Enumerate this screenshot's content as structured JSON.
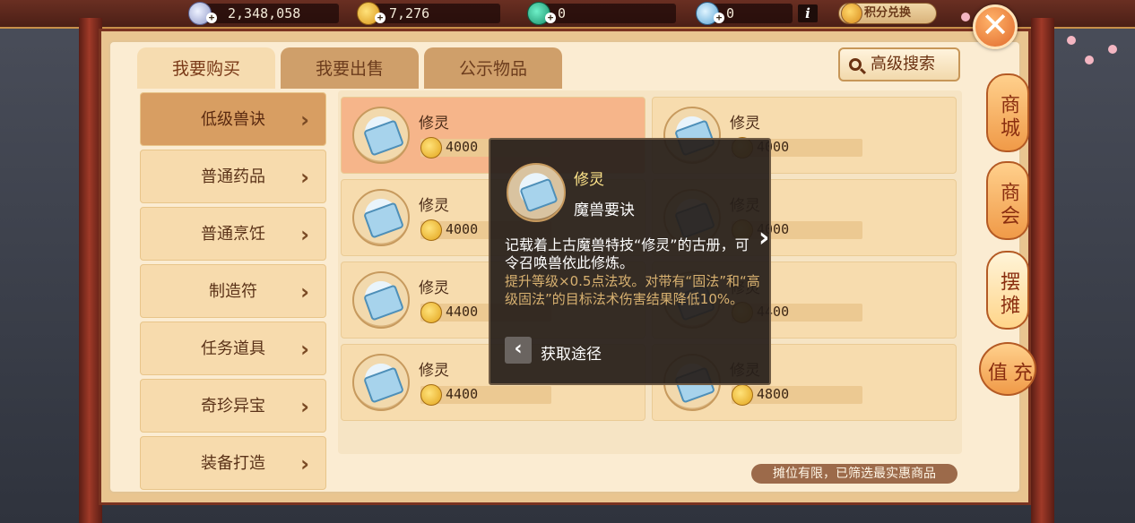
{
  "colors": {
    "accent": "#e06a2c",
    "panel_bg": "#fbecd2",
    "tab_active_bg": "#f6dcb0",
    "item_selected_bg": "#f6b58a",
    "tooltip_bg": "#261e1a",
    "tooltip_title": "#ffe58a",
    "tooltip_effect": "#d8b170"
  },
  "resources": [
    {
      "icon": "silver-coin-icon",
      "value": "2,348,058"
    },
    {
      "icon": "gold-coin-icon",
      "value": "7,276"
    },
    {
      "icon": "jade-icon",
      "value": "0"
    },
    {
      "icon": "gem-icon",
      "value": "0"
    }
  ],
  "topbar": {
    "info_label": "i",
    "points_exchange": "积分兑换",
    "close_label": "✕"
  },
  "tabs": [
    {
      "label": "我要购买",
      "active": true
    },
    {
      "label": "我要出售",
      "active": false
    },
    {
      "label": "公示物品",
      "active": false
    }
  ],
  "advanced_search": "高级搜索",
  "categories": [
    {
      "label": "低级兽诀",
      "active": true
    },
    {
      "label": "普通药品",
      "active": false
    },
    {
      "label": "普通烹饪",
      "active": false
    },
    {
      "label": "制造符",
      "active": false
    },
    {
      "label": "任务道具",
      "active": false
    },
    {
      "label": "奇珍异宝",
      "active": false
    },
    {
      "label": "装备打造",
      "active": false
    }
  ],
  "items": [
    {
      "name": "修灵",
      "price": "4000"
    },
    {
      "name": "修灵",
      "price": "4000"
    },
    {
      "name": "修灵",
      "price": "4000"
    },
    {
      "name": "修灵",
      "price": "4000"
    },
    {
      "name": "修灵",
      "price": "4400"
    },
    {
      "name": "修灵",
      "price": "4400"
    },
    {
      "name": "修灵",
      "price": "4400"
    },
    {
      "name": "修灵",
      "price": "4800"
    }
  ],
  "tooltip": {
    "name": "修灵",
    "type": "魔兽要诀",
    "description": "记载着上古魔兽特技“修灵”的古册，可令召唤兽依此修炼。",
    "effect": "提升等级×0.5点法攻。对带有“固法”和“高级固法”的目标法术伤害结果降低10%。",
    "source_label": "获取途径"
  },
  "notice": "摊位有限，已筛选最实惠商品",
  "side_tabs": [
    {
      "label": "商城",
      "active": false
    },
    {
      "label": "商会",
      "active": false
    },
    {
      "label": "摆摊",
      "active": true
    },
    {
      "label": "充值",
      "active": false
    }
  ]
}
